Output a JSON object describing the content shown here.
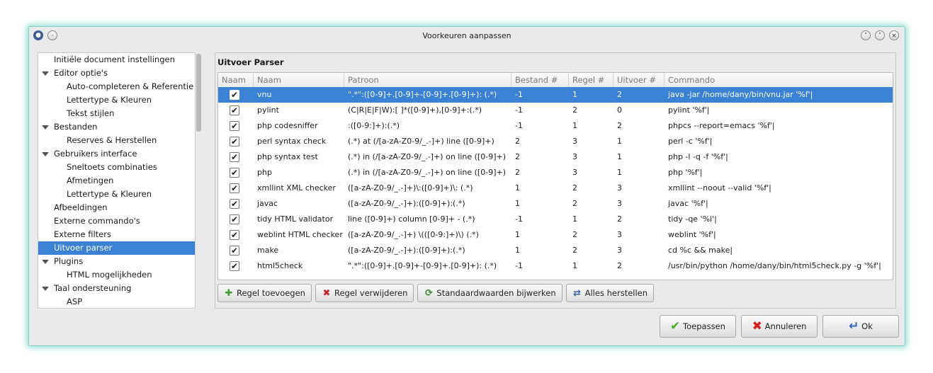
{
  "window": {
    "title": "Voorkeuren aanpassen"
  },
  "sidebar": {
    "items": [
      {
        "label": "Initiële document instellingen"
      },
      {
        "label": "Editor optie's"
      },
      {
        "label": "Auto-completeren & Referentie"
      },
      {
        "label": "Lettertype & Kleuren"
      },
      {
        "label": "Tekst stijlen"
      },
      {
        "label": "Bestanden"
      },
      {
        "label": "Reserves & Herstellen"
      },
      {
        "label": "Gebruikers interface"
      },
      {
        "label": "Sneltoets combinaties"
      },
      {
        "label": "Afmetingen"
      },
      {
        "label": "Lettertype & Kleuren"
      },
      {
        "label": "Afbeeldingen"
      },
      {
        "label": "Externe commando's"
      },
      {
        "label": "Externe filters"
      },
      {
        "label": "Uitvoer parser"
      },
      {
        "label": "Plugins"
      },
      {
        "label": "HTML mogelijkheden"
      },
      {
        "label": "Taal ondersteuning"
      },
      {
        "label": "ASP"
      }
    ]
  },
  "section": {
    "title": "Uitvoer Parser"
  },
  "table": {
    "columns": [
      "Naam",
      "Naam",
      "Patroon",
      "Bestand #",
      "Regel #",
      "Uitvoer #",
      "Commando"
    ],
    "rows": [
      {
        "name": "vnu",
        "pattern": "\".*\":([0-9]+.[0-9]+-[0-9]+.[0-9]+): (.*)",
        "file": "-1",
        "line": "1",
        "output": "2",
        "command": "java -jar /home/dany/bin/vnu.jar '%f'|"
      },
      {
        "name": "pylint",
        "pattern": "(C|R|E|F|W):[ ]*([0-9]+),[0-9]+:(.*)",
        "file": "-1",
        "line": "2",
        "output": "0",
        "command": "pylint '%f'|"
      },
      {
        "name": "php codesniffer",
        "pattern": ":([0-9:]+):(.*)",
        "file": "-1",
        "line": "1",
        "output": "2",
        "command": "phpcs --report=emacs '%f'|"
      },
      {
        "name": "perl syntax check",
        "pattern": "(.*) at (/[a-zA-Z0-9/_.-]+) line ([0-9]+)",
        "file": "2",
        "line": "3",
        "output": "1",
        "command": "perl -c '%f'|"
      },
      {
        "name": "php syntax test",
        "pattern": "(.*) in (/[a-zA-Z0-9/_.-]+) on line ([0-9]+)",
        "file": "2",
        "line": "3",
        "output": "1",
        "command": "php -l -q -f '%f'|"
      },
      {
        "name": "php",
        "pattern": "(.*) in (/[a-zA-Z0-9/_.-]+) on line ([0-9]+)",
        "file": "2",
        "line": "3",
        "output": "1",
        "command": "php '%f'|"
      },
      {
        "name": "xmllint XML checker",
        "pattern": "([a-zA-Z0-9/_.-]+)\\:([0-9]+)\\: (.*)",
        "file": "1",
        "line": "2",
        "output": "3",
        "command": "xmllint --noout --valid '%f'|"
      },
      {
        "name": "javac",
        "pattern": "([a-zA-Z0-9/_.-]+):([0-9]+):(.*)",
        "file": "1",
        "line": "2",
        "output": "3",
        "command": "javac '%f'|"
      },
      {
        "name": "tidy HTML validator",
        "pattern": "line ([0-9]+) column [0-9]+ - (.*)",
        "file": "-1",
        "line": "1",
        "output": "2",
        "command": "tidy -qe '%i'|"
      },
      {
        "name": "weblint HTML checker",
        "pattern": "([a-zA-Z0-9/_.-]+) \\(([0-9:]+)\\) (.*)",
        "file": "1",
        "line": "2",
        "output": "3",
        "command": "weblint '%f'|"
      },
      {
        "name": "make",
        "pattern": "([a-zA-Z0-9/_.-]+):([0-9]+):(.*)",
        "file": "1",
        "line": "2",
        "output": "3",
        "command": "cd %c && make|"
      },
      {
        "name": "html5check",
        "pattern": "\".*\":([0-9]+.[0-9]+-[0-9]+.[0-9]+): (.*)",
        "file": "-1",
        "line": "1",
        "output": "2",
        "command": "/usr/bin/python /home/dany/bin/html5check.py -g '%f'|"
      }
    ]
  },
  "buttons": {
    "add": "Regel toevoegen",
    "remove": "Regel verwijderen",
    "update_defaults": "Standaardwaarden bijwerken",
    "reset_all": "Alles herstellen",
    "apply": "Toepassen",
    "cancel": "Annuleren",
    "ok": "Ok"
  },
  "colors": {
    "selection": "#3b82d4",
    "apply_icon": "#4caf2a",
    "cancel_icon": "#d42020",
    "ok_icon": "#2d66c4"
  }
}
